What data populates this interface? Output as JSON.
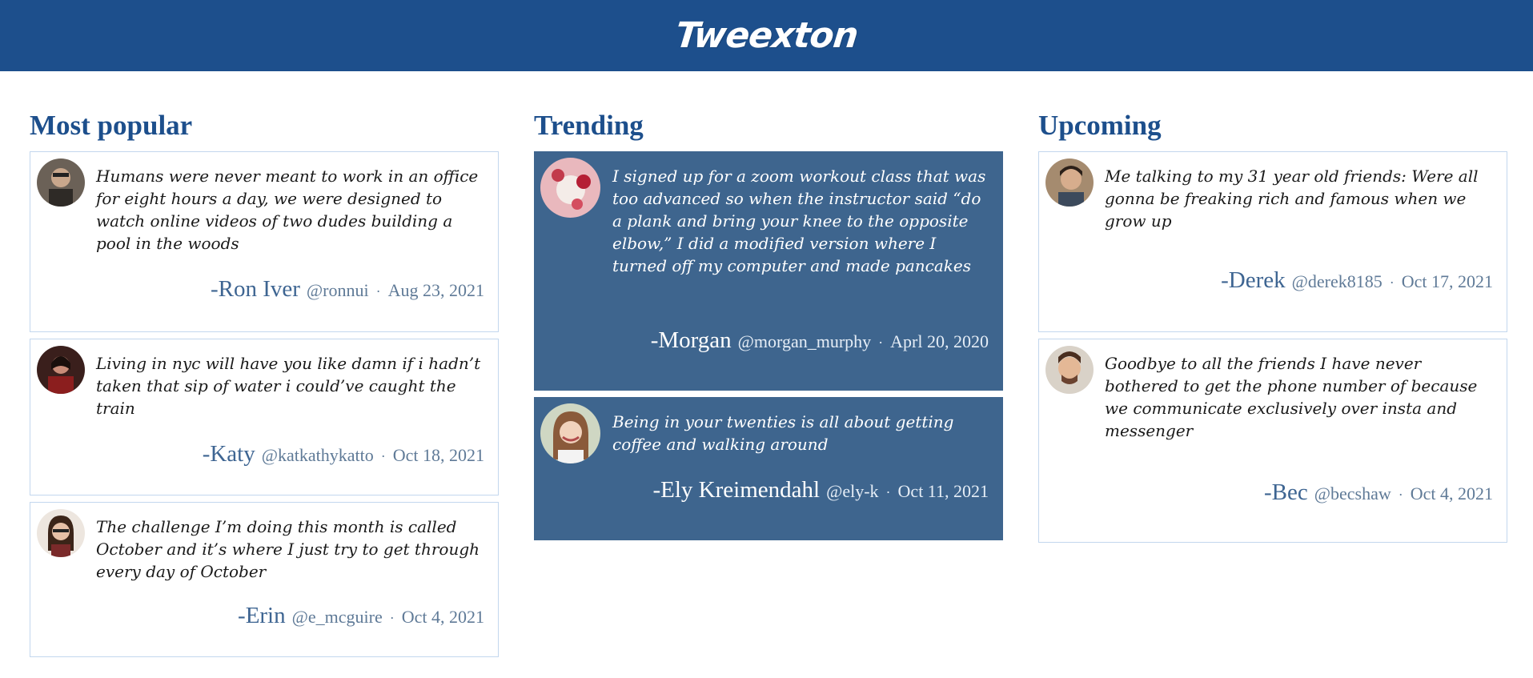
{
  "header": {
    "logo": "Tweexton",
    "background_color": "#1d4f8c"
  },
  "colors": {
    "accent": "#1d4f8c",
    "trending_card": "#3e658e",
    "card_border": "#c3d7ee"
  },
  "columns": [
    {
      "title": "Most popular",
      "tweets": [
        {
          "avatar": "user-avatar-photo",
          "text": "Humans were never meant to work in an office for eight hours a day, we were designed to watch online videos of two dudes building a pool in the woods",
          "author": "-Ron Iver",
          "handle": "@ronnui",
          "separator": "·",
          "date": "Aug 23, 2021"
        },
        {
          "avatar": "user-avatar-photo",
          "text": "Living in nyc will have you like damn if i hadn’t taken that sip of water i could’ve caught the train",
          "author": "-Katy",
          "handle": "@katkathykatto",
          "separator": "·",
          "date": "Oct 18, 2021"
        },
        {
          "avatar": "user-avatar-photo",
          "text": "The challenge I’m doing this month is called October and it’s where I just try to get through every day of October",
          "author": "-Erin",
          "handle": "@e_mcguire",
          "separator": "·",
          "date": "Oct 4, 2021"
        }
      ]
    },
    {
      "title": "Trending",
      "tweets": [
        {
          "avatar": "user-avatar-photo",
          "text": "I signed up for a zoom workout class that was too advanced so when the instructor said “do a plank and bring your knee to the opposite elbow,” I did a modified version where I turned off my computer and made pancakes",
          "author": "-Morgan",
          "handle": "@morgan_murphy",
          "separator": "·",
          "date": "Aprl 20, 2020"
        },
        {
          "avatar": "user-avatar-photo",
          "text": "Being in your twenties is all about getting coffee and walking around",
          "author": "-Ely Kreimendahl",
          "handle": "@ely-k",
          "separator": "·",
          "date": "Oct 11, 2021"
        }
      ]
    },
    {
      "title": "Upcoming",
      "tweets": [
        {
          "avatar": "user-avatar-photo",
          "text": "Me talking to my 31 year old friends: Were all gonna be freaking rich and famous when we grow up",
          "author": "-Derek",
          "handle": "@derek8185",
          "separator": "·",
          "date": "Oct 17, 2021"
        },
        {
          "avatar": "user-avatar-photo",
          "text": "Goodbye to all the friends I have never bothered to get the phone number of because we communicate exclusively over insta and messenger",
          "author": "-Bec",
          "handle": "@becshaw",
          "separator": "·",
          "date": "Oct 4, 2021"
        }
      ]
    }
  ]
}
